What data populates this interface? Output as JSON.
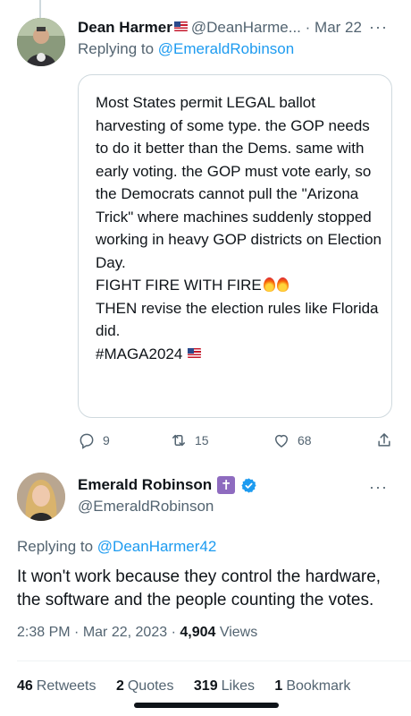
{
  "reply": {
    "author_name": "Dean Harmer",
    "handle": "@DeanHarme...",
    "separator": "·",
    "date": "Mar 22",
    "replying_prefix": "Replying to",
    "replying_to": "@EmeraldRobinson",
    "card_text": "Most States permit LEGAL ballot harvesting of some type. the GOP needs to do it better than the Dems. same with early voting. the GOP must vote early, so the Democrats cannot pull the \"Arizona Trick\" where machines suddenly stopped working in heavy GOP districts on Election Day.\nFIGHT FIRE WITH FIRE",
    "card_text_2": "THEN revise the election rules like Florida did.\n#MAGA2024",
    "reply_count": "9",
    "retweet_count": "15",
    "like_count": "68"
  },
  "main": {
    "author_name": "Emerald Robinson",
    "handle": "@EmeraldRobinson",
    "replying_prefix": "Replying to",
    "replying_to": "@DeanHarmer42",
    "text": "It won't work because they control the hardware, the software and the people counting the votes.",
    "time": "2:38 PM",
    "dot": "·",
    "date": "Mar 22, 2023",
    "views_count": "4,904",
    "views_label": "Views",
    "stats": [
      {
        "count": "46",
        "label": "Retweets"
      },
      {
        "count": "2",
        "label": "Quotes"
      },
      {
        "count": "319",
        "label": "Likes"
      },
      {
        "count": "1",
        "label": "Bookmark"
      }
    ]
  },
  "more_glyph": "···",
  "icons": [
    "reply-icon",
    "retweet-icon",
    "like-icon",
    "share-icon",
    "verified-badge-icon",
    "cross-icon",
    "more-icon",
    "us-flag-icon",
    "fire-icon"
  ],
  "colors": {
    "accent": "#1d9bf0",
    "muted": "#536471",
    "text": "#0f1419",
    "border": "#cfd9de"
  }
}
